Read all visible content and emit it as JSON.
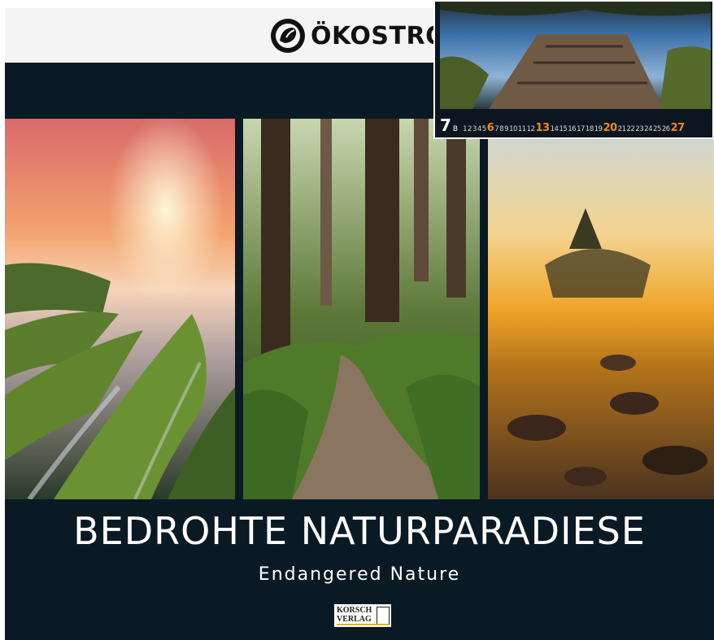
{
  "brand": {
    "name": "ÖKOSTRO",
    "icon": "leaf-fist-logo-icon"
  },
  "title": "BEDROHTE NATURPARADIESE",
  "subtitle": "Endangered Nature",
  "publisher": {
    "line1": "KORSCH",
    "line2": "VERLAG",
    "logo": "korsch-verlag-logo"
  },
  "photos": [
    {
      "subject": "mossy coastal rocks at sunset"
    },
    {
      "subject": "redwood forest trail"
    },
    {
      "subject": "misty rocky shore at sunrise"
    }
  ],
  "inset": {
    "subject": "wooden jetty on a lake",
    "calendar": {
      "month_number": "7",
      "month_suffix": "B",
      "days": [
        "1",
        "2",
        "3",
        "4",
        "5",
        "6",
        "7",
        "8",
        "9",
        "10",
        "11",
        "12",
        "13",
        "14",
        "15",
        "16",
        "17",
        "18",
        "19",
        "20",
        "21",
        "22",
        "23",
        "24",
        "25",
        "26",
        "27"
      ],
      "highlighted_days": [
        "6",
        "13",
        "20",
        "27"
      ],
      "highlight_color": "#f08a1c"
    }
  },
  "colors": {
    "background": "#0a1a24",
    "band": "#f4f4f4",
    "accent": "#f08a1c",
    "publisher_line": "#e2b400"
  }
}
